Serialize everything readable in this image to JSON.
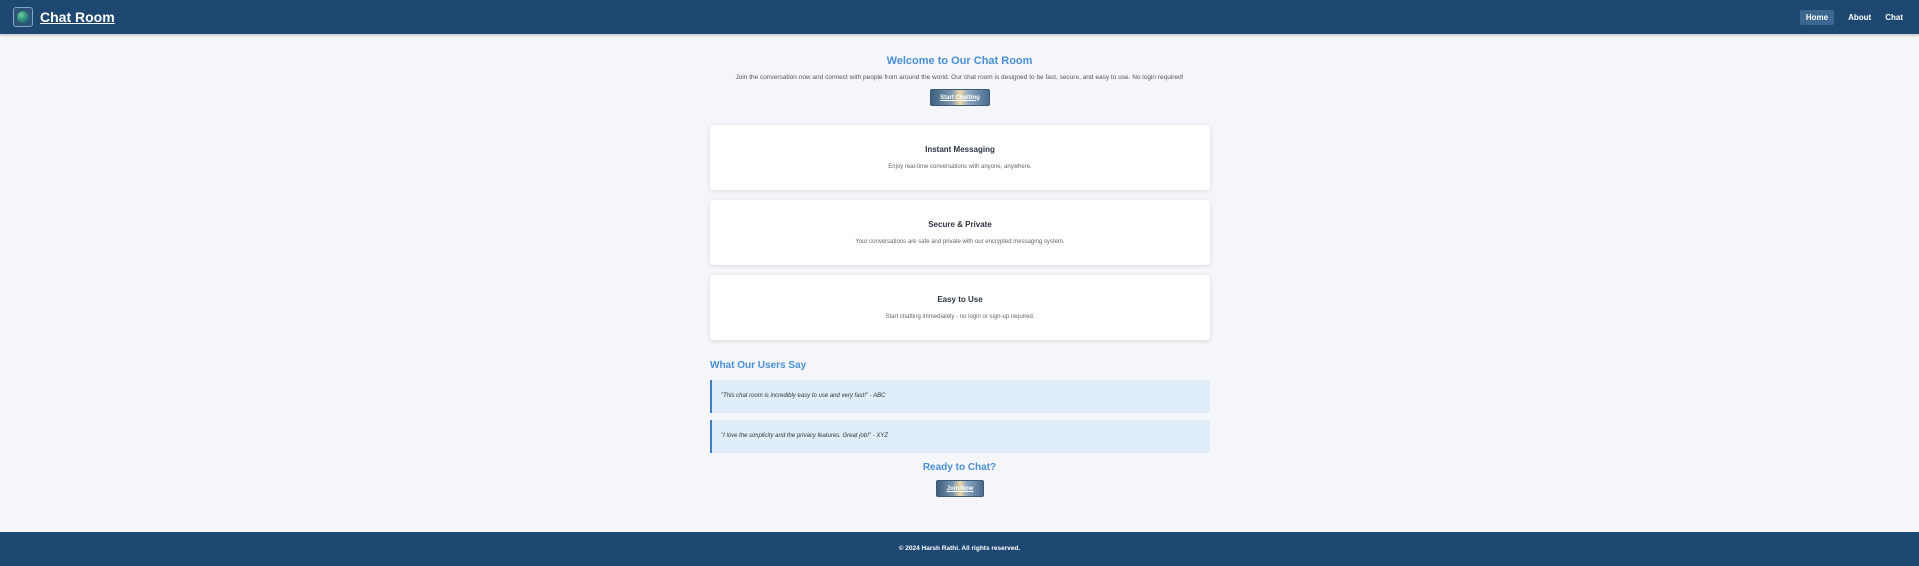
{
  "navbar": {
    "brand": "Chat Room",
    "logo_icon": "globe-icon",
    "links": [
      {
        "label": "Home",
        "active": true
      },
      {
        "label": "About",
        "active": false
      },
      {
        "label": "Chat",
        "active": false
      }
    ]
  },
  "hero": {
    "title": "Welcome to Our Chat Room",
    "text": "Join the conversation now and connect with people from around the world. Our chat room is designed to be fast, secure, and easy to use. No login required!",
    "button": "Start Chatting"
  },
  "features": [
    {
      "title": "Instant Messaging",
      "text": "Enjoy real-time conversations with anyone, anywhere."
    },
    {
      "title": "Secure & Private",
      "text": "Your conversations are safe and private with our encrypted messaging system."
    },
    {
      "title": "Easy to Use",
      "text": "Start chatting immediately - no login or sign-up required."
    }
  ],
  "testimonials": {
    "title": "What Our Users Say",
    "items": [
      "\"This chat room is incredibly easy to use and very fast!\" - ABC",
      "\"I love the simplicity and the privacy features. Great job!\" - XYZ"
    ]
  },
  "cta": {
    "title": "Ready to Chat?",
    "button": "Join Now"
  },
  "footer": {
    "text": "© 2024 Harsh Rathi. All rights reserved."
  },
  "colors": {
    "navbar": "#1e4872",
    "accent": "#4a8fd6",
    "quote_bg": "#dfeef8",
    "page_bg": "#f4f6fa"
  }
}
